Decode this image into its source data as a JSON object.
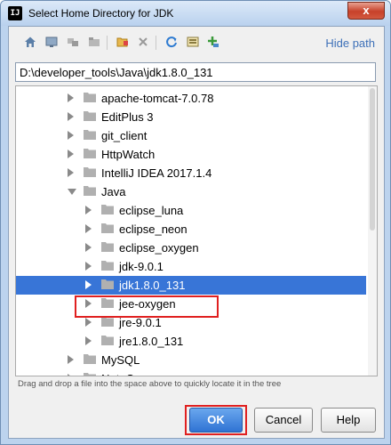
{
  "window": {
    "title": "Select Home Directory for JDK",
    "app_icon_text": "IJ",
    "close_glyph": "x"
  },
  "toolbar": {
    "icons": [
      "home-icon",
      "desktop-icon",
      "project-icon",
      "module-icon",
      "new-folder-icon",
      "delete-icon",
      "refresh-icon",
      "show-hidden-icon",
      "add-icon"
    ],
    "hide_path_label": "Hide path"
  },
  "path_field": {
    "value": "D:\\developer_tools\\Java\\jdk1.8.0_131"
  },
  "tree": {
    "items": [
      {
        "label": "apache-tomcat-7.0.78",
        "level": 1,
        "state": "collapsed"
      },
      {
        "label": "EditPlus 3",
        "level": 1,
        "state": "collapsed"
      },
      {
        "label": "git_client",
        "level": 1,
        "state": "collapsed"
      },
      {
        "label": "HttpWatch",
        "level": 1,
        "state": "collapsed"
      },
      {
        "label": "IntelliJ IDEA 2017.1.4",
        "level": 1,
        "state": "collapsed"
      },
      {
        "label": "Java",
        "level": 1,
        "state": "expanded"
      },
      {
        "label": "eclipse_luna",
        "level": 2,
        "state": "collapsed"
      },
      {
        "label": "eclipse_neon",
        "level": 2,
        "state": "collapsed"
      },
      {
        "label": "eclipse_oxygen",
        "level": 2,
        "state": "collapsed"
      },
      {
        "label": "jdk-9.0.1",
        "level": 2,
        "state": "collapsed"
      },
      {
        "label": "jdk1.8.0_131",
        "level": 2,
        "state": "collapsed",
        "selected": true
      },
      {
        "label": "jee-oxygen",
        "level": 2,
        "state": "collapsed"
      },
      {
        "label": "jre-9.0.1",
        "level": 2,
        "state": "collapsed"
      },
      {
        "label": "jre1.8.0_131",
        "level": 2,
        "state": "collapsed"
      },
      {
        "label": "MySQL",
        "level": 1,
        "state": "collapsed"
      },
      {
        "label": "NoteCase",
        "level": 1,
        "state": "collapsed"
      }
    ]
  },
  "hint": "Drag and drop a file into the space above to quickly locate it in the tree",
  "buttons": {
    "ok": "OK",
    "cancel": "Cancel",
    "help": "Help"
  },
  "colors": {
    "selection": "#3875d7",
    "link": "#3d70b8",
    "highlight": "#e02020"
  }
}
